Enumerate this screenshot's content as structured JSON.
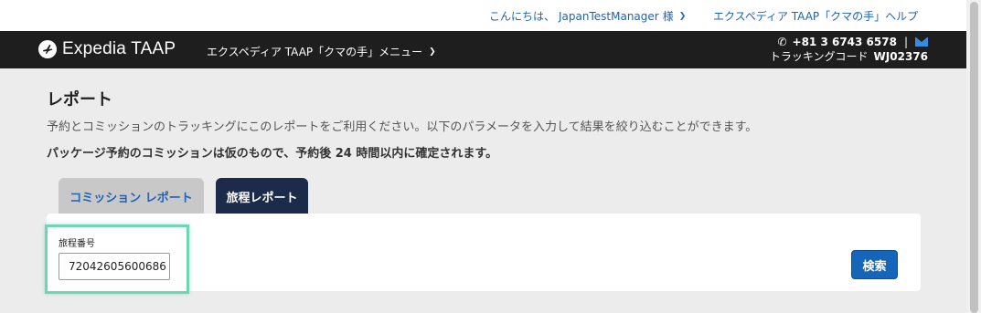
{
  "topbar": {
    "greeting_prefix": "こんにちは、",
    "user_name": "JapanTestManager",
    "greeting_suffix": "様",
    "help_link": "エクスペディア TAAP「クマの手」ヘルプ"
  },
  "navbar": {
    "brand": "Expedia TAAP",
    "menu_label": "エクスペディア TAAP「クマの手」メニュー",
    "phone": "+81 3 6743 6578",
    "separator": "|",
    "tracking_label": "トラッキングコード",
    "tracking_code": "WJ02376"
  },
  "page": {
    "title": "レポート",
    "description": "予約とコミッションのトラッキングにこのレポートをご利用ください。以下のパラメータを入力して結果を絞り込むことができます。",
    "note": "パッケージ予約のコミッションは仮のもので、予約後 24 時間以内に確定されます。"
  },
  "tabs": [
    {
      "label": "コミッション レポート",
      "active": false
    },
    {
      "label": "旅程レポート",
      "active": true
    }
  ],
  "form": {
    "itinerary_label": "旅程番号",
    "itinerary_value": "72042605600686",
    "search_button": "検索"
  },
  "colors": {
    "link": "#1a64b8",
    "navbar_bg": "#1e1e1e",
    "active_tab": "#1c2b4a",
    "search_button": "#1565b8",
    "highlight": "#6fd6b5"
  }
}
